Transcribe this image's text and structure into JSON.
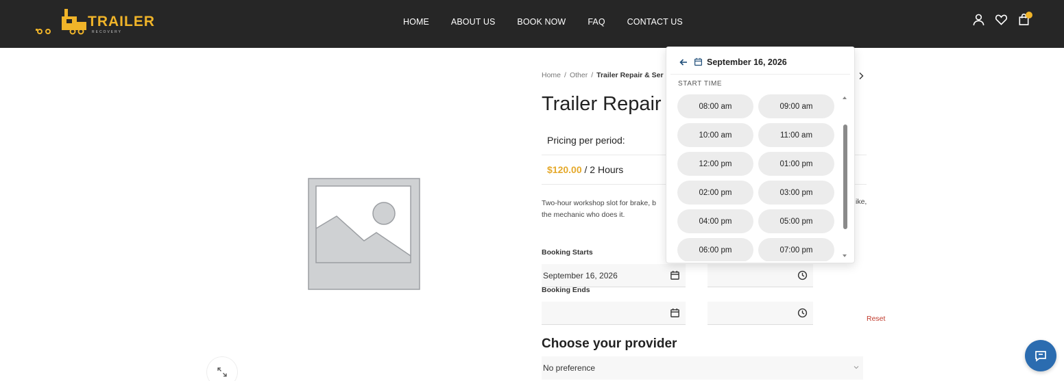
{
  "brand": {
    "name": "TRAILER",
    "tagline": "RECOVERY",
    "accent": "#f0b429"
  },
  "nav": [
    {
      "label": "HOME"
    },
    {
      "label": "ABOUT US"
    },
    {
      "label": "BOOK NOW"
    },
    {
      "label": "FAQ"
    },
    {
      "label": "CONTACT US"
    }
  ],
  "header_icons": [
    "user-icon",
    "heart-icon",
    "bag-icon"
  ],
  "breadcrumb": {
    "home": "Home",
    "category": "Other",
    "current": "Trailer Repair & Ser"
  },
  "product": {
    "title": "Trailer Repair",
    "pricing_label": "Pricing per period:",
    "price": "$120.00",
    "price_period": "/ 2 Hours",
    "description": "Two-hour workshop slot for brake, b",
    "description_line2": "the mechanic who does it.",
    "description_end": "ike,"
  },
  "booking": {
    "starts_label": "Booking Starts",
    "starts_date": "September 16, 2026",
    "starts_time": "",
    "ends_label": "Booking Ends",
    "ends_date": "",
    "ends_time": "",
    "reset_label": "Reset"
  },
  "provider": {
    "title": "Choose your provider",
    "selected": "No preference"
  },
  "time_picker": {
    "date": "September 16, 2026",
    "heading": "START TIME",
    "slots": [
      "08:00 am",
      "09:00 am",
      "10:00 am",
      "11:00 am",
      "12:00 pm",
      "01:00 pm",
      "02:00 pm",
      "03:00 pm",
      "04:00 pm",
      "05:00 pm",
      "06:00 pm",
      "07:00 pm"
    ]
  },
  "colors": {
    "header_bg": "#262626",
    "price": "#e5a92b",
    "reset": "#c0392b",
    "chat": "#2b6cb0"
  }
}
